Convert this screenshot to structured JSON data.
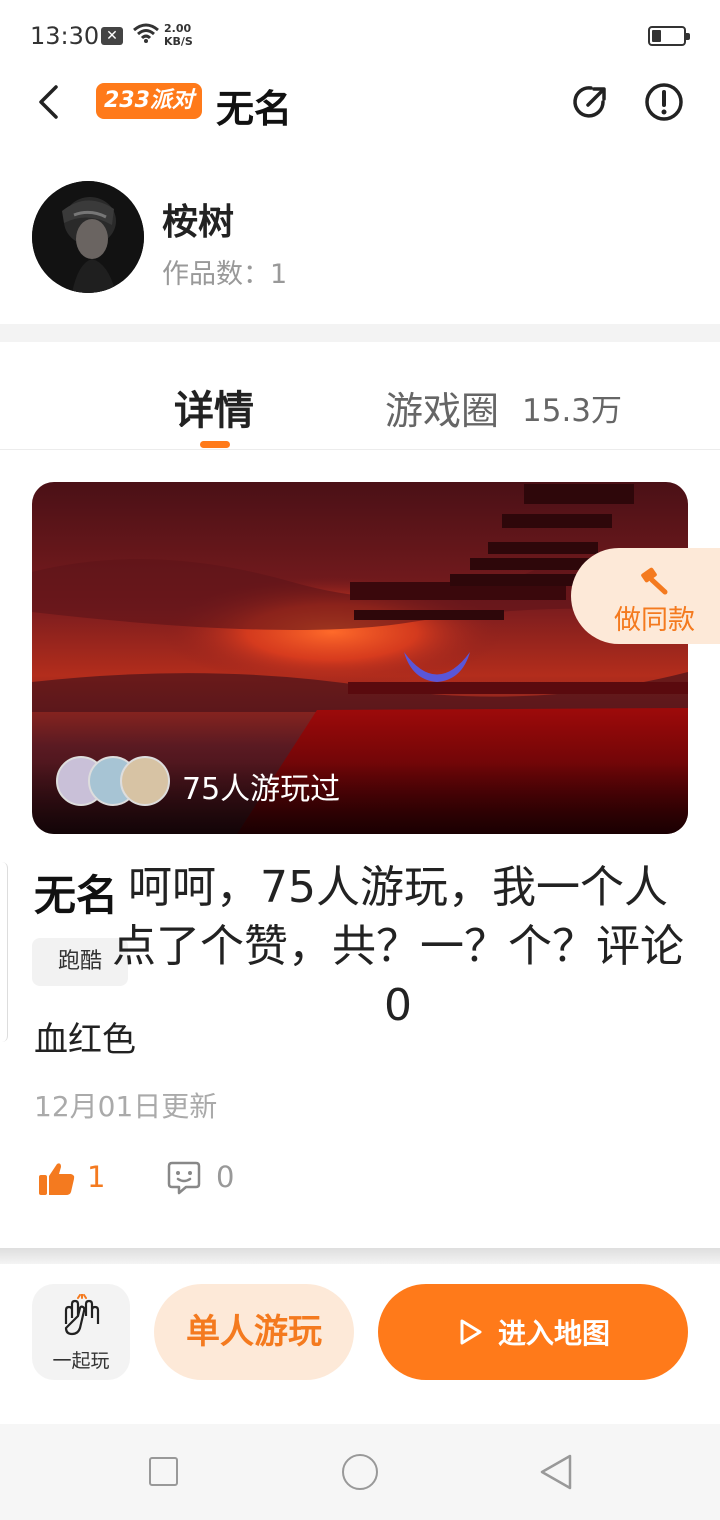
{
  "status_bar": {
    "time": "13:30",
    "speed_value": "2.00",
    "speed_unit": "KB/S"
  },
  "header": {
    "brand": "233派对",
    "title": "无名"
  },
  "author": {
    "name": "桉树",
    "works_label": "作品数：",
    "works_count": "1"
  },
  "tabs": {
    "details": "详情",
    "circle": "游戏圈",
    "circle_count": "15.3万"
  },
  "cover": {
    "played_text": "75人游玩过",
    "make_same": "做同款"
  },
  "game": {
    "title": "无名",
    "tag": "跑酷",
    "description": "血红色",
    "overlay_text": "呵呵，75人游玩，我一个人点了个赞，共？一？个？评论0",
    "updated": "12月01日更新",
    "likes": "1",
    "comments": "0"
  },
  "actions": {
    "together": "一起玩",
    "solo": "单人游玩",
    "enter": "进入地图"
  },
  "colors": {
    "accent": "#ff7a1a",
    "accent_light": "#fde9d8"
  }
}
